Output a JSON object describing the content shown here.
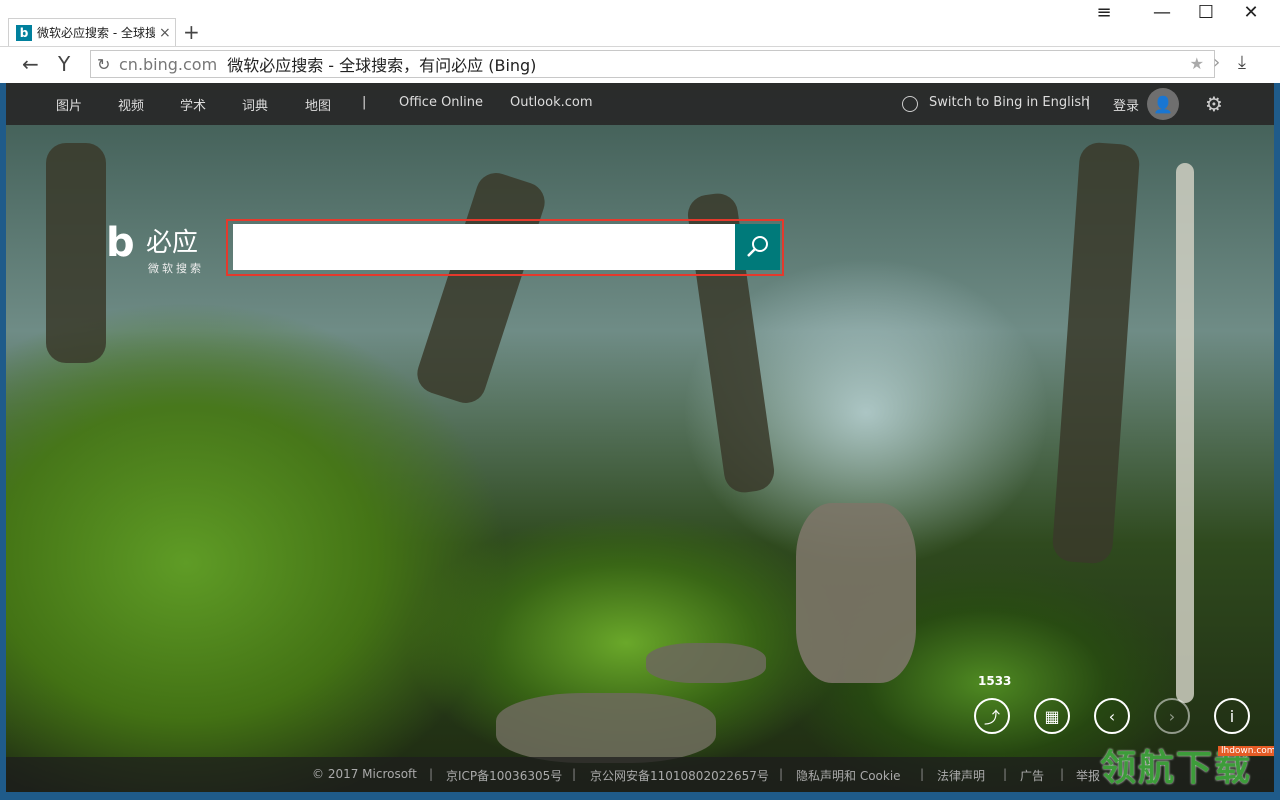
{
  "browser": {
    "tab_title": "微软必应搜索 - 全球搜",
    "tab_favicon": "b",
    "tab_close": "×",
    "new_tab": "+",
    "window_controls": {
      "menu": "≡",
      "minimize": "—",
      "maximize": "☐",
      "close": "✕"
    },
    "back": "←",
    "y_button": "Y",
    "reload": "↻",
    "url_host": "cn.bing.com",
    "url_title": "微软必应搜索 - 全球搜索，有问必应 (Bing)",
    "star": "★",
    "forward_arrow": "›",
    "download": "⤓"
  },
  "topnav": {
    "items": [
      "图片",
      "视频",
      "学术",
      "词典",
      "地图"
    ],
    "divider": "|",
    "office": "Office Online",
    "outlook": "Outlook.com",
    "switch_english": "Switch to Bing in English",
    "login": "登录",
    "avatar_glyph": "👤",
    "gear": "⚙"
  },
  "logo": {
    "mark": "b",
    "name": "必应",
    "sub": "微软搜索"
  },
  "search": {
    "value": "",
    "placeholder": ""
  },
  "controls": {
    "count": "1533",
    "share": "⤴",
    "qr": "▦",
    "prev": "‹",
    "next": "›",
    "info": "i"
  },
  "footer": {
    "copyright": "© 2017 Microsoft",
    "icp": "京ICP备10036305号",
    "police": "京公网安备11010802022657号",
    "privacy": "隐私声明和 Cookie",
    "legal": "法律声明",
    "ads": "广告",
    "report": "举报",
    "sep": "|"
  },
  "watermark": {
    "text": "领航下载",
    "url": "lhdown.com"
  },
  "colors": {
    "search_button": "#007a7a",
    "highlight": "#e5392c",
    "nav_bg": "#282828"
  }
}
